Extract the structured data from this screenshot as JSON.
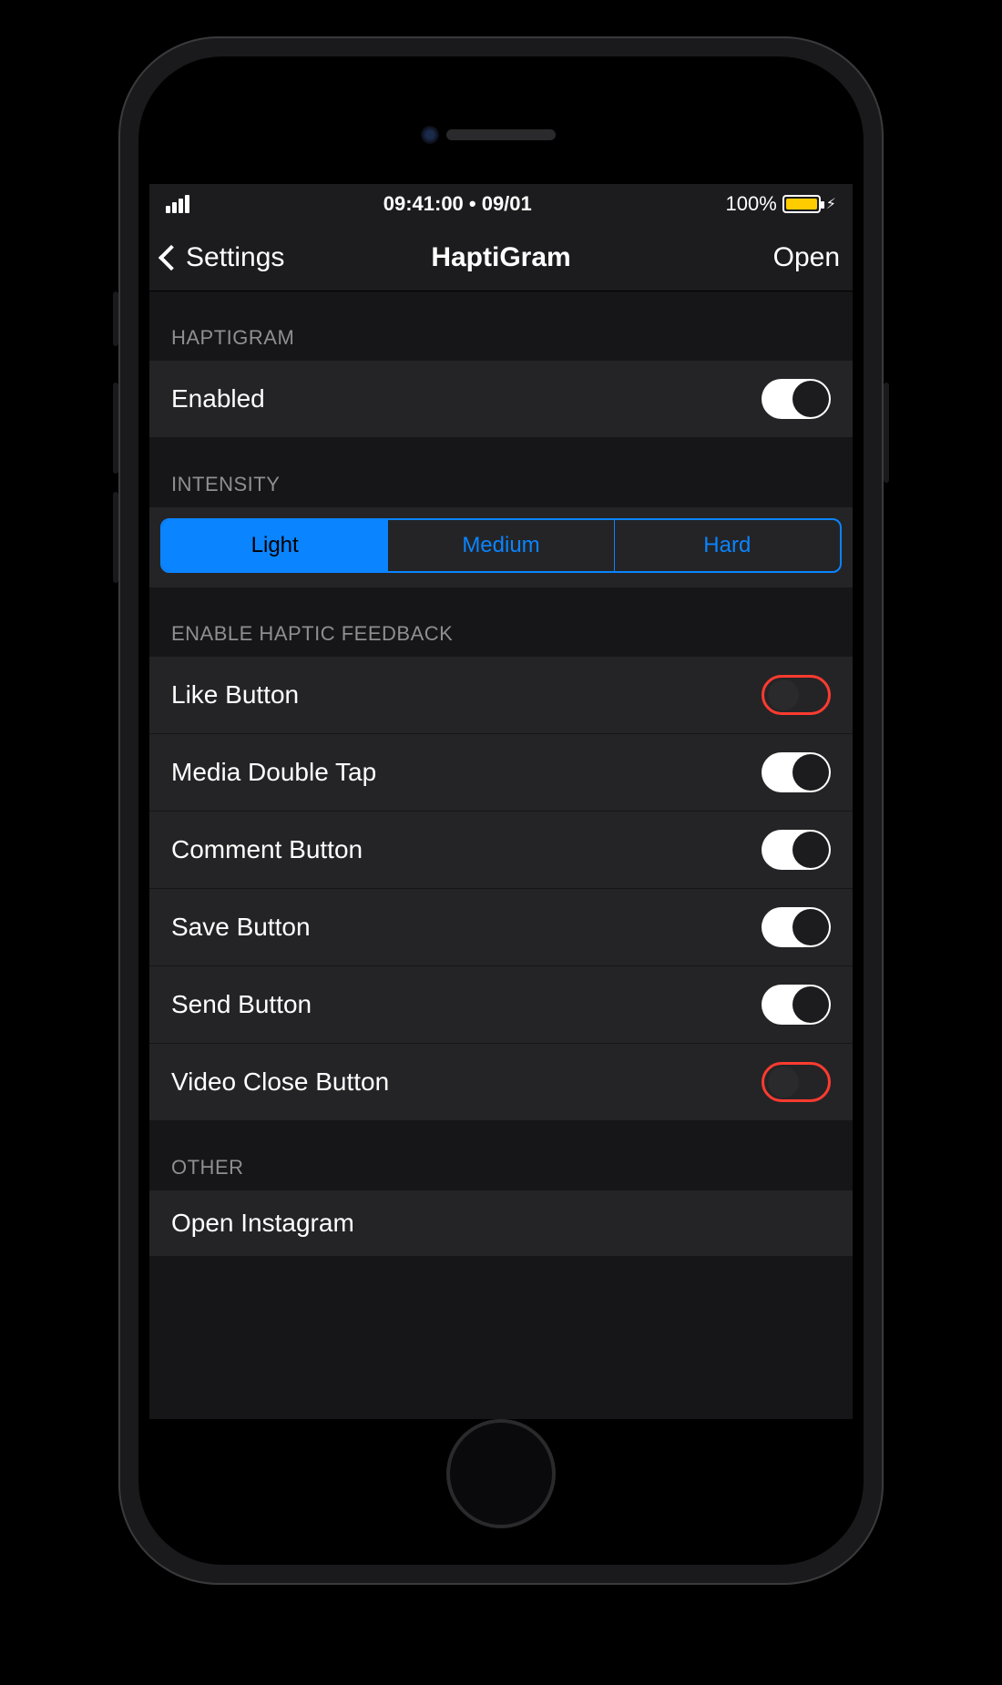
{
  "status_bar": {
    "time_date": "09:41:00 • 09/01",
    "battery_pct": "100%"
  },
  "nav": {
    "back_label": "Settings",
    "title": "HaptiGram",
    "action_label": "Open"
  },
  "sections": {
    "haptigram": {
      "header": "HAPTIGRAM",
      "enabled_label": "Enabled",
      "enabled_state": "on"
    },
    "intensity": {
      "header": "INTENSITY",
      "options": [
        "Light",
        "Medium",
        "Hard"
      ],
      "selected": "Light"
    },
    "feedback": {
      "header": "ENABLE HAPTIC FEEDBACK",
      "items": [
        {
          "label": "Like Button",
          "state": "off"
        },
        {
          "label": "Media Double Tap",
          "state": "on"
        },
        {
          "label": "Comment Button",
          "state": "on"
        },
        {
          "label": "Save Button",
          "state": "on"
        },
        {
          "label": "Send Button",
          "state": "on"
        },
        {
          "label": "Video Close Button",
          "state": "off"
        }
      ]
    },
    "other": {
      "header": "OTHER",
      "open_instagram_label": "Open Instagram"
    }
  }
}
